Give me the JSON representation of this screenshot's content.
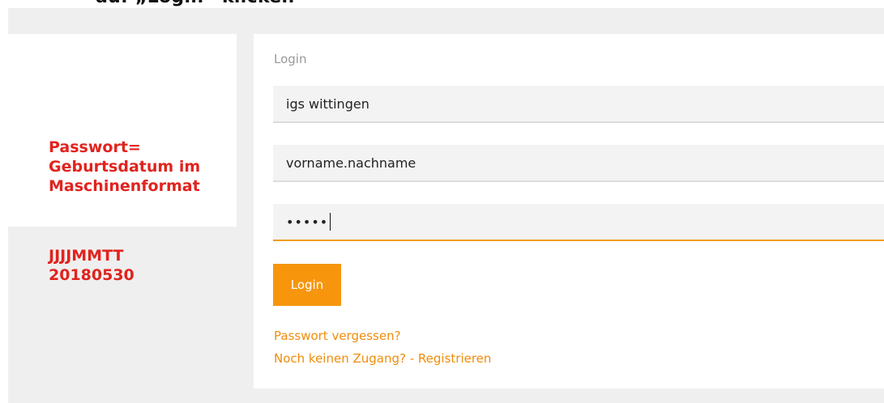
{
  "caption": {
    "text": "auf „Login“ klicken"
  },
  "annotation": {
    "password_hint": "Passwort=\nGeburtsdatum im\nMaschinenformat",
    "format_example": "JJJJMMTT\n20180530"
  },
  "login_form": {
    "title": "Login",
    "school_value": "igs wittingen",
    "username_value": "vorname.nachname",
    "password_mask": "•••••",
    "submit_label": "Login",
    "forgot_password_link": "Passwort vergessen?",
    "register_link": "Noch keinen Zugang? - Registrieren"
  },
  "colors": {
    "accent": "#f7960d",
    "annotation_red": "#e1231e",
    "background_gray": "#efefef"
  }
}
